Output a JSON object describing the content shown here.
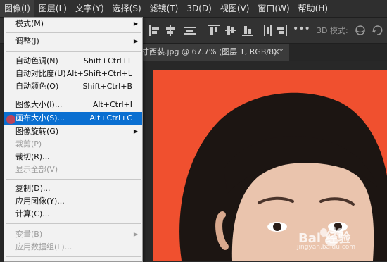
{
  "menubar": {
    "items": [
      {
        "label": "图像(I)",
        "active": true
      },
      {
        "label": "图层(L)"
      },
      {
        "label": "文字(Y)"
      },
      {
        "label": "选择(S)"
      },
      {
        "label": "滤镜(T)"
      },
      {
        "label": "3D(D)"
      },
      {
        "label": "视图(V)"
      },
      {
        "label": "窗口(W)"
      },
      {
        "label": "帮助(H)"
      }
    ]
  },
  "optionsbar": {
    "three_d_mode_label": "3D 模式:"
  },
  "document_tab": {
    "title": "寸西装.jpg @ 67.7% (图层 1, RGB/8) *",
    "close": "×"
  },
  "image_menu": {
    "items": [
      {
        "label": "模式(M)",
        "shortcut": "",
        "submenu": true,
        "enabled": true
      },
      {
        "label": "调整(J)",
        "shortcut": "",
        "submenu": true,
        "enabled": true
      },
      {
        "label": "自动色调(N)",
        "shortcut": "Shift+Ctrl+L",
        "enabled": true
      },
      {
        "label": "自动对比度(U)",
        "shortcut": "Alt+Shift+Ctrl+L",
        "enabled": true
      },
      {
        "label": "自动颜色(O)",
        "shortcut": "Shift+Ctrl+B",
        "enabled": true
      },
      {
        "label": "图像大小(I)...",
        "shortcut": "Alt+Ctrl+I",
        "enabled": true
      },
      {
        "label": "画布大小(S)...",
        "shortcut": "Alt+Ctrl+C",
        "enabled": true,
        "highlighted": true
      },
      {
        "label": "图像旋转(G)",
        "shortcut": "",
        "submenu": true,
        "enabled": true
      },
      {
        "label": "裁剪(P)",
        "shortcut": "",
        "enabled": false
      },
      {
        "label": "裁切(R)...",
        "shortcut": "",
        "enabled": true
      },
      {
        "label": "显示全部(V)",
        "shortcut": "",
        "enabled": false
      },
      {
        "label": "复制(D)...",
        "shortcut": "",
        "enabled": true
      },
      {
        "label": "应用图像(Y)...",
        "shortcut": "",
        "enabled": true
      },
      {
        "label": "计算(C)...",
        "shortcut": "",
        "enabled": true
      },
      {
        "label": "变量(B)",
        "shortcut": "",
        "submenu": true,
        "enabled": false
      },
      {
        "label": "应用数据组(L)...",
        "shortcut": "",
        "enabled": false
      }
    ]
  },
  "watermark": {
    "brand": "Bai 经验",
    "url": "jingyan.baidu.com"
  },
  "colors": {
    "highlight": "#0a6fd1",
    "photo_background": "#f0502f",
    "menu_bg": "#f2f2f2"
  }
}
